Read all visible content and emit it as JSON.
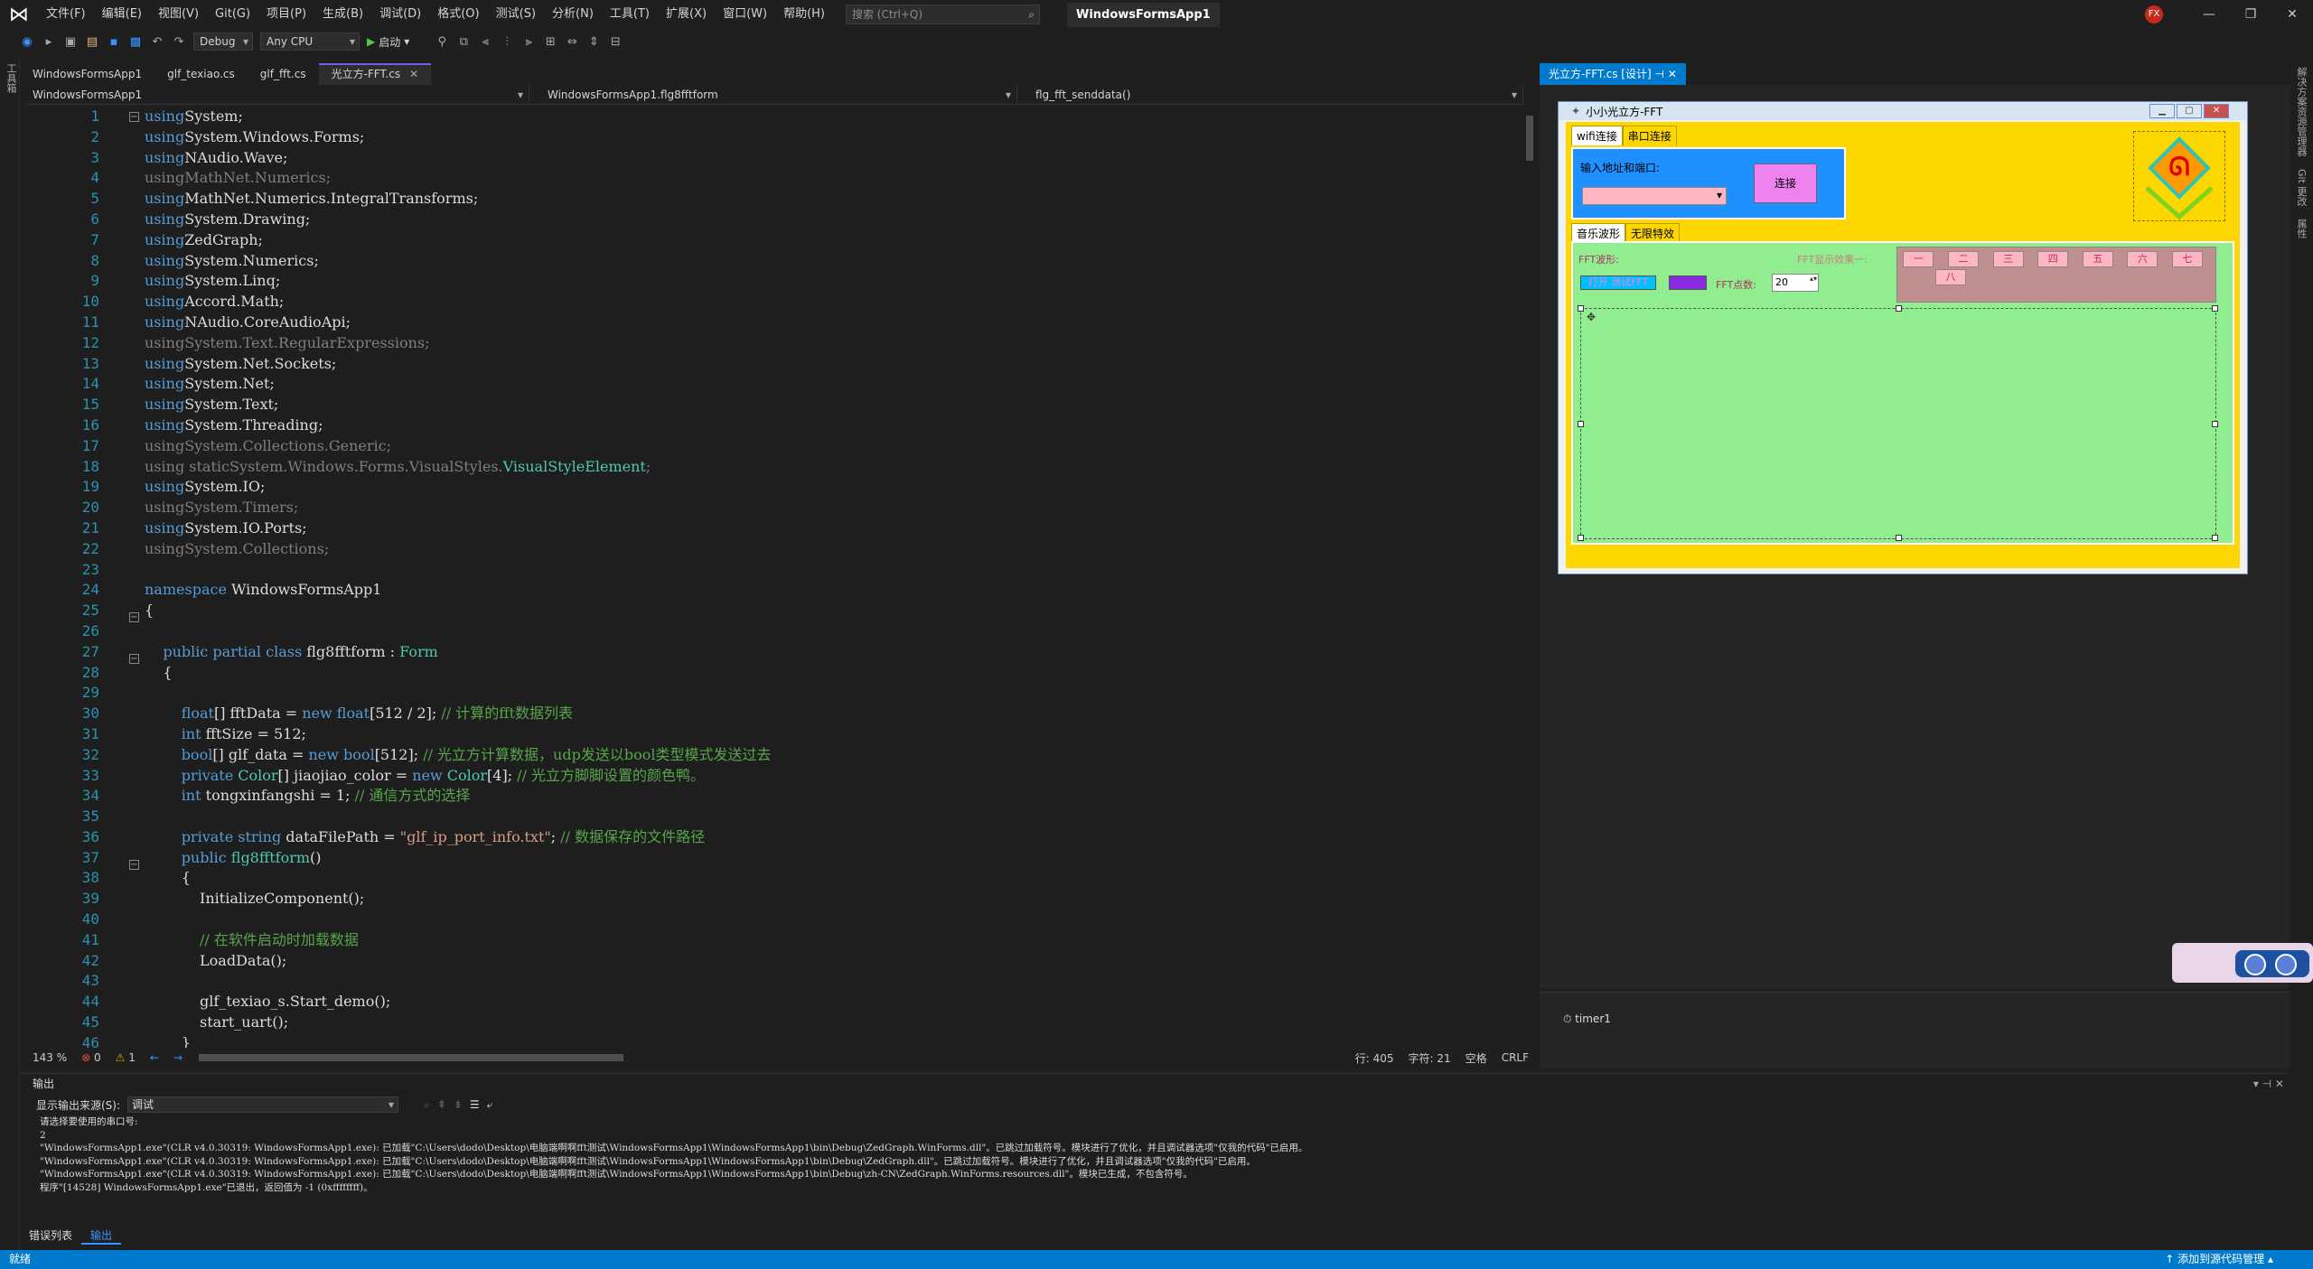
{
  "titlebar": {
    "menus": [
      "文件(F)",
      "编辑(E)",
      "视图(V)",
      "Git(G)",
      "项目(P)",
      "生成(B)",
      "调试(D)",
      "格式(O)",
      "测试(S)",
      "分析(N)",
      "工具(T)",
      "扩展(X)",
      "窗口(W)",
      "帮助(H)"
    ],
    "search_placeholder": "搜索 (Ctrl+Q)",
    "solution_name": "WindowsFormsApp1",
    "avatar": "FX",
    "minimize": "—",
    "restore": "❐",
    "close": "✕"
  },
  "toolbar": {
    "config": "Debug",
    "platform": "Any CPU",
    "start": "启动"
  },
  "left_strip": "工具箱",
  "right_strip": [
    "解决方案资源管理器",
    "Git 更改",
    "属性"
  ],
  "doc_tabs": [
    {
      "label": "WindowsFormsApp1"
    },
    {
      "label": "glf_texiao.cs"
    },
    {
      "label": "glf_fft.cs"
    },
    {
      "label": "光立方-FFT.cs"
    }
  ],
  "navbar": {
    "project": "WindowsFormsApp1",
    "class": "WindowsFormsApp1.flg8fftform",
    "member": "flg_fft_senddata()"
  },
  "editor": {
    "lines": [
      [
        [
          "kw",
          "using"
        ],
        [
          "",
          "System;"
        ]
      ],
      [
        [
          "kw",
          "using"
        ],
        [
          "",
          "System.Windows.Forms;"
        ]
      ],
      [
        [
          "kw",
          "using"
        ],
        [
          "",
          "NAudio.Wave;"
        ]
      ],
      [
        [
          "dim",
          "using"
        ],
        [
          "dim",
          "MathNet.Numerics;"
        ]
      ],
      [
        [
          "kw",
          "using"
        ],
        [
          "",
          "MathNet.Numerics.IntegralTransforms;"
        ]
      ],
      [
        [
          "kw",
          "using"
        ],
        [
          "",
          "System.Drawing;"
        ]
      ],
      [
        [
          "kw",
          "using"
        ],
        [
          "",
          "ZedGraph;"
        ]
      ],
      [
        [
          "kw",
          "using"
        ],
        [
          "",
          "System.Numerics;"
        ]
      ],
      [
        [
          "kw",
          "using"
        ],
        [
          "",
          "System.Linq;"
        ]
      ],
      [
        [
          "kw",
          "using"
        ],
        [
          "",
          "Accord.Math;"
        ]
      ],
      [
        [
          "kw",
          "using"
        ],
        [
          "",
          "NAudio.CoreAudioApi;"
        ]
      ],
      [
        [
          "dim",
          "using"
        ],
        [
          "dim",
          "System.Text.RegularExpressions;"
        ]
      ],
      [
        [
          "kw",
          "using"
        ],
        [
          "",
          "System.Net.Sockets;"
        ]
      ],
      [
        [
          "kw",
          "using"
        ],
        [
          "",
          "System.Net;"
        ]
      ],
      [
        [
          "kw",
          "using"
        ],
        [
          "",
          "System.Text;"
        ]
      ],
      [
        [
          "kw",
          "using"
        ],
        [
          "",
          "System.Threading;"
        ]
      ],
      [
        [
          "dim",
          "using"
        ],
        [
          "dim",
          "System.Collections.Generic;"
        ]
      ],
      [
        [
          "dim",
          "using static"
        ],
        [
          "dim",
          "System.Windows.Forms.VisualStyles."
        ],
        [
          "ty",
          "VisualStyleElement"
        ],
        [
          "dim",
          ";"
        ]
      ],
      [
        [
          "kw",
          "using"
        ],
        [
          "",
          "System.IO;"
        ]
      ],
      [
        [
          "dim",
          "using"
        ],
        [
          "dim",
          "System.Timers;"
        ]
      ],
      [
        [
          "kw",
          "using"
        ],
        [
          "",
          "System.IO.Ports;"
        ]
      ],
      [
        [
          "dim",
          "using"
        ],
        [
          "dim",
          "System.Collections;"
        ]
      ],
      [],
      [
        [
          "kw",
          "namespace"
        ],
        [
          "",
          " WindowsFormsApp1"
        ]
      ],
      [
        [
          "",
          "{"
        ]
      ],
      [],
      [
        [
          "",
          "    "
        ],
        [
          "kw",
          "public partial class"
        ],
        [
          "",
          " flg8fftform : "
        ],
        [
          "ty",
          "Form"
        ]
      ],
      [
        [
          "",
          "    {"
        ]
      ],
      [],
      [
        [
          "",
          "        "
        ],
        [
          "kw",
          "float"
        ],
        [
          "",
          "[] fftData = "
        ],
        [
          "kw",
          "new float"
        ],
        [
          "",
          "[512 / 2]; "
        ],
        [
          "cm",
          "// 计算的fft数据列表"
        ]
      ],
      [
        [
          "",
          "        "
        ],
        [
          "kw",
          "int"
        ],
        [
          "",
          " fftSize = 512;"
        ]
      ],
      [
        [
          "",
          "        "
        ],
        [
          "kw",
          "bool"
        ],
        [
          "",
          "[] glf_data = "
        ],
        [
          "kw",
          "new bool"
        ],
        [
          "",
          "[512]; "
        ],
        [
          "cm",
          "// 光立方计算数据，udp发送以bool类型模式发送过去"
        ]
      ],
      [
        [
          "",
          "        "
        ],
        [
          "kw",
          "private"
        ],
        [
          "",
          " "
        ],
        [
          "ty",
          "Color"
        ],
        [
          "",
          "[] jiaojiao_color = "
        ],
        [
          "kw",
          "new"
        ],
        [
          "",
          " "
        ],
        [
          "ty",
          "Color"
        ],
        [
          "",
          "[4]; "
        ],
        [
          "cm",
          "// 光立方脚脚设置的颜色鸭。"
        ]
      ],
      [
        [
          "",
          "        "
        ],
        [
          "kw",
          "int"
        ],
        [
          "",
          " tongxinfangshi = 1; "
        ],
        [
          "cm",
          "// 通信方式的选择"
        ]
      ],
      [],
      [
        [
          "",
          "        "
        ],
        [
          "kw",
          "private string"
        ],
        [
          "",
          " dataFilePath = "
        ],
        [
          "st",
          "\"glf_ip_port_info.txt\""
        ],
        [
          "",
          "; "
        ],
        [
          "cm",
          "// 数据保存的文件路径"
        ]
      ],
      [
        [
          "",
          "        "
        ],
        [
          "kw",
          "public"
        ],
        [
          "",
          " "
        ],
        [
          "ty",
          "flg8fftform"
        ],
        [
          "",
          "()"
        ]
      ],
      [
        [
          "",
          "        {"
        ]
      ],
      [
        [
          "",
          "            InitializeComponent();"
        ]
      ],
      [],
      [
        [
          "",
          "            "
        ],
        [
          "cm",
          "// 在软件启动时加载数据"
        ]
      ],
      [
        [
          "",
          "            LoadData();"
        ]
      ],
      [],
      [
        [
          "",
          "            glf_texiao_s.Start_demo();"
        ]
      ],
      [
        [
          "",
          "            start_uart();"
        ]
      ],
      [
        [
          "",
          "        }"
        ]
      ]
    ]
  },
  "editor_status": {
    "zoom": "143 %",
    "errors": "0",
    "warnings": "1",
    "line": "行: 405",
    "char": "字符: 21",
    "ws": "空格",
    "eol": "CRLF"
  },
  "designer": {
    "tab_label": "光立方-FFT.cs [设计]",
    "form_title": "小小光立方-FFT",
    "top_tabs": [
      "wifi连接",
      "串口连接"
    ],
    "addr_label": "输入地址和端口:",
    "connect": "连接",
    "bottom_tabs": [
      "音乐波形",
      "无限特效"
    ],
    "fft_wave_label": "FFT波形:",
    "fft_effect_label": "FFT显示效果一:",
    "open_fft": "打开 测试FFT",
    "points_label": "FFT点数:",
    "points_value": "20",
    "effects": [
      "一",
      "二",
      "三",
      "四",
      "五",
      "六",
      "七",
      "八"
    ],
    "timer": "timer1"
  },
  "output": {
    "title": "输出",
    "source_label": "显示输出来源(S):",
    "source_value": "调试",
    "lines": [
      "请选择要使用的串口号:",
      "2",
      "\"WindowsFormsApp1.exe\"(CLR v4.0.30319: WindowsFormsApp1.exe): 已加载\"C:\\Users\\dodo\\Desktop\\电脑端啊啊fft测试\\WindowsFormsApp1\\WindowsFormsApp1\\bin\\Debug\\ZedGraph.WinForms.dll\"。已跳过加载符号。模块进行了优化，并且调试器选项\"仅我的代码\"已启用。",
      "\"WindowsFormsApp1.exe\"(CLR v4.0.30319: WindowsFormsApp1.exe): 已加载\"C:\\Users\\dodo\\Desktop\\电脑端啊啊fft测试\\WindowsFormsApp1\\WindowsFormsApp1\\bin\\Debug\\ZedGraph.dll\"。已跳过加载符号。模块进行了优化，并且调试器选项\"仅我的代码\"已启用。",
      "\"WindowsFormsApp1.exe\"(CLR v4.0.30319: WindowsFormsApp1.exe): 已加载\"C:\\Users\\dodo\\Desktop\\电脑端啊啊fft测试\\WindowsFormsApp1\\WindowsFormsApp1\\bin\\Debug\\zh-CN\\ZedGraph.WinForms.resources.dll\"。模块已生成，不包含符号。",
      "程序\"[14528] WindowsFormsApp1.exe\"已退出，返回值为 -1 (0xffffffff)。"
    ]
  },
  "out_tabs": [
    "错误列表",
    "输出"
  ],
  "statusbar": {
    "ready": "就绪",
    "source_control": "↑ 添加到源代码管理 ▴"
  }
}
